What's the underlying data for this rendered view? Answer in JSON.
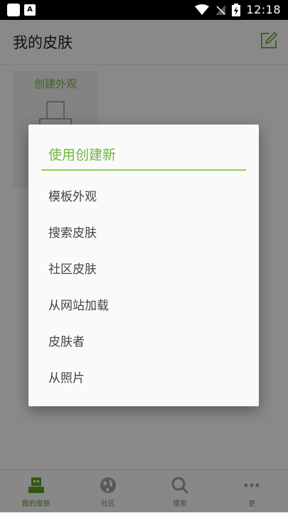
{
  "status_bar": {
    "time": "12:18"
  },
  "app_bar": {
    "title": "我的皮肤"
  },
  "content": {
    "card_label": "创建外观"
  },
  "dialog": {
    "title": "使用创建新",
    "items": [
      "模板外观",
      "搜索皮肤",
      "社区皮肤",
      "从网站加载",
      "皮肤者",
      "从照片"
    ]
  },
  "bottom_nav": {
    "items": [
      {
        "label": "我的皮肤",
        "icon": "skin-icon",
        "active": true
      },
      {
        "label": "社区",
        "icon": "globe-icon",
        "active": false
      },
      {
        "label": "搜索",
        "icon": "search-icon",
        "active": false
      },
      {
        "label": "更",
        "icon": "more-icon",
        "active": false
      }
    ]
  },
  "colors": {
    "accent": "#6fb83a",
    "nav_active": "#5aa126"
  }
}
